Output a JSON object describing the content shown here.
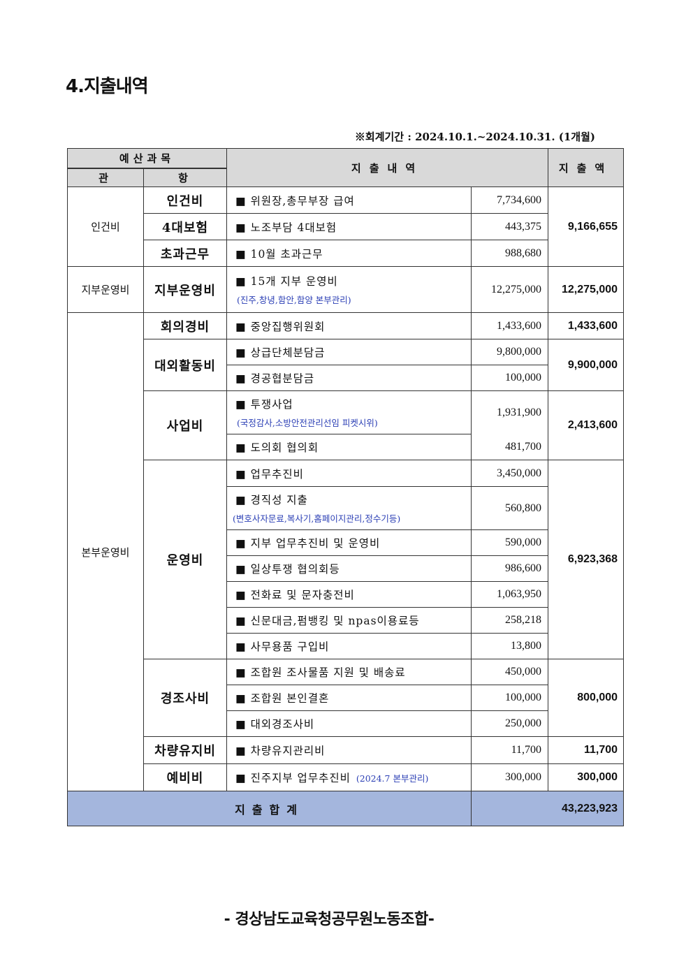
{
  "title": "4.지출내역",
  "period": "※회계기간 : 2024.10.1.~2024.10.31. (1개월)",
  "header": {
    "budget": "예산과목",
    "kwan": "관",
    "hang": "항",
    "detail": "지출내역",
    "amount": "지출액"
  },
  "rows": {
    "r1": {
      "kwan": "인건비",
      "hang": "인건비",
      "desc": "■ 위원장,총무부장 급여",
      "amount": "7,734,600",
      "total": "9,166,655"
    },
    "r2": {
      "hang": "4대보험",
      "desc": "■ 노조부담 4대보험",
      "amount": "443,375"
    },
    "r3": {
      "hang": "초과근무",
      "desc": "■ 10월 초과근무",
      "amount": "988,680"
    },
    "r4": {
      "kwan": "지부운영비",
      "hang": "지부운영비",
      "desc": "■ 15개 지부 운영비",
      "sub": "(진주,창녕,함안,함양 본부관리)",
      "amount": "12,275,000",
      "total": "12,275,000"
    },
    "r5": {
      "kwan": "본부운영비",
      "hang": "회의경비",
      "desc": "■ 중앙집행위원회",
      "amount": "1,433,600",
      "total": "1,433,600"
    },
    "r6": {
      "hang": "대외활동비",
      "desc": "■ 상급단체분담금",
      "amount": "9,800,000",
      "total": "9,900,000"
    },
    "r7": {
      "desc": "■ 경공협분담금",
      "amount": "100,000"
    },
    "r8": {
      "hang": "사업비",
      "desc": "■ 투쟁사업",
      "sub": "(국정감사,소방안전관리선임 피켓시위)",
      "amount": "1,931,900",
      "total": "2,413,600"
    },
    "r9": {
      "desc": "■  도의회 협의회",
      "amount": "481,700"
    },
    "r10": {
      "hang": "운영비",
      "desc": "■ 업무추진비",
      "amount": "3,450,000",
      "total": "6,923,368"
    },
    "r11": {
      "desc": "■ 경직성 지출",
      "sub": "(변호사자문료,복사기,홈페이지관리,정수기등)",
      "amount": "560,800"
    },
    "r12": {
      "desc": "■ 지부 업무추진비 및 운영비",
      "amount": "590,000"
    },
    "r13": {
      "desc": "■ 일상투쟁 협의회등",
      "amount": "986,600"
    },
    "r14": {
      "desc": "■ 전화료 및 문자충전비",
      "amount": "1,063,950"
    },
    "r15": {
      "desc": "■ 신문대금,펌뱅킹 및 npas이용료등",
      "amount": "258,218"
    },
    "r16": {
      "desc": "■ 사무용품 구입비",
      "amount": "13,800"
    },
    "r17": {
      "hang": "경조사비",
      "desc": "■ 조합원 조사물품 지원 및 배송료",
      "amount": "450,000",
      "total": "800,000"
    },
    "r18": {
      "desc": "■ 조합원 본인결혼",
      "amount": "100,000"
    },
    "r19": {
      "desc": "■ 대외경조사비",
      "amount": "250,000"
    },
    "r20": {
      "hang": "차량유지비",
      "desc": "■ 차량유지관리비",
      "amount": "11,700",
      "total": "11,700"
    },
    "r21": {
      "hang": "예비비",
      "desc": "■ 진주지부 업무추진비",
      "sub": "(2024.7 본부관리)",
      "amount": "300,000",
      "total": "300,000"
    }
  },
  "sum": {
    "label": "지출합계",
    "total": "43,223,923"
  },
  "footer": "- 경상남도교육청공무원노동조합-"
}
